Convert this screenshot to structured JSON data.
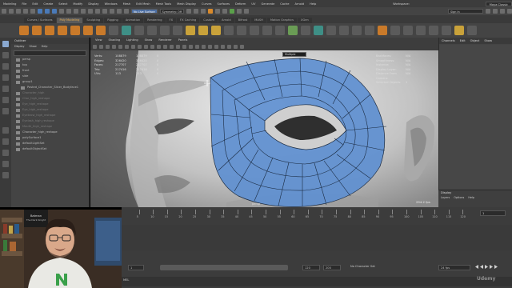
{
  "menubar": {
    "workspace_mode": "Modeling",
    "items": [
      "File",
      "Edit",
      "Create",
      "Select",
      "Modify",
      "Display",
      "Windows",
      "Mesh",
      "Edit Mesh",
      "Mesh Tools",
      "Mesh Display",
      "Curves",
      "Surfaces",
      "Deform",
      "UV",
      "Generate",
      "Cache",
      "Arnold",
      "Help"
    ],
    "workspace_label": "Workspace:",
    "workspace_value": "Maya Classic"
  },
  "statusline": {
    "symmetry": "Symmetry: Off",
    "no_live": "No Live Surface",
    "sign_in": "Sign In"
  },
  "shelf": {
    "tabs": [
      "Curves / Surfaces",
      "Poly Modeling",
      "Sculpting",
      "Rigging",
      "Animation",
      "Rendering",
      "FX",
      "FX Caching",
      "Custom",
      "Arnold",
      "Bifrost",
      "MASH",
      "Motion Graphics",
      "XGen"
    ],
    "active_tab": "Poly Modeling"
  },
  "outliner": {
    "panel_title": "Outliner",
    "menu": [
      "Display",
      "Show",
      "Help"
    ],
    "items": [
      {
        "label": "persp",
        "dim": false,
        "level": 1,
        "selected": false
      },
      {
        "label": "top",
        "dim": false,
        "level": 1,
        "selected": false
      },
      {
        "label": "front",
        "dim": false,
        "level": 1,
        "selected": false
      },
      {
        "label": "side",
        "dim": false,
        "level": 1,
        "selected": false
      },
      {
        "label": "group1",
        "dim": false,
        "level": 1,
        "selected": false
      },
      {
        "label": "Pasted_Character_Slicer_Bodyface1",
        "dim": false,
        "level": 2,
        "selected": false
      },
      {
        "label": "Character_high",
        "dim": true,
        "level": 1,
        "selected": false
      },
      {
        "label": "Char_high_reshape",
        "dim": true,
        "level": 1,
        "selected": false
      },
      {
        "label": "Eye_high_reshape",
        "dim": true,
        "level": 1,
        "selected": false
      },
      {
        "label": "Eye_high_reshape",
        "dim": true,
        "level": 1,
        "selected": false
      },
      {
        "label": "Eyebrow_high_reshape",
        "dim": true,
        "level": 1,
        "selected": false
      },
      {
        "label": "Eyelash_high_reshape",
        "dim": true,
        "level": 1,
        "selected": false
      },
      {
        "label": "Mouth_high_reshape",
        "dim": true,
        "level": 1,
        "selected": false
      },
      {
        "label": "Character_high_reshape",
        "dim": false,
        "level": 1,
        "selected": false
      },
      {
        "label": "polySurface1",
        "dim": false,
        "level": 1,
        "selected": false
      },
      {
        "label": "defaultLightSet",
        "dim": false,
        "level": 1,
        "selected": false
      },
      {
        "label": "defaultObjectSet",
        "dim": false,
        "level": 1,
        "selected": false
      }
    ]
  },
  "viewport": {
    "menu": [
      "View",
      "Shading",
      "Lighting",
      "Show",
      "Renderer",
      "Panels"
    ],
    "hud_rows": [
      {
        "label": "Verts:",
        "a": "108879",
        "b": "108879",
        "c": "0"
      },
      {
        "label": "Edges:",
        "a": "326420",
        "b": "326420",
        "c": "0"
      },
      {
        "label": "Faces:",
        "a": "217707",
        "b": "217707",
        "c": "0"
      },
      {
        "label": "Tris:",
        "a": "217416",
        "b": "217416",
        "c": "0"
      },
      {
        "label": "UVs:",
        "a": "113",
        "b": "113",
        "c": "0"
      }
    ],
    "hud_field": "Multiple",
    "hud_right": [
      {
        "label": "Backfaces:",
        "value": "N/A"
      },
      {
        "label": "Smoothness:",
        "value": "N/A"
      },
      {
        "label": "Instance:",
        "value": "N/A"
      },
      {
        "label": "Display Layer:",
        "value": "N/A"
      },
      {
        "label": "Distance From Camera:",
        "value": "N/A"
      },
      {
        "label": "Selected Objects:",
        "value": "1"
      }
    ],
    "camera": "persp",
    "fps": "294.2 fps",
    "mesh_color": "#5e8fd0",
    "skin_color": "#c9c9c9"
  },
  "rightpanel": {
    "tabs": [
      "Channels",
      "Edit",
      "Object",
      "Show"
    ],
    "layers_title": "Display",
    "layers_menu": [
      "Layers",
      "Options",
      "Help"
    ]
  },
  "timeline": {
    "ticks": [
      "5",
      "10",
      "15",
      "20",
      "25",
      "30",
      "35",
      "40",
      "45",
      "50",
      "55",
      "60",
      "65",
      "70",
      "75",
      "80",
      "85",
      "90",
      "95",
      "100",
      "105",
      "110",
      "115",
      "120"
    ],
    "current_frame": "1",
    "range_start": "1",
    "range_end_a": "120",
    "range_end_b": "200",
    "charset": "No Character Set",
    "fps": "24 fps",
    "mel": "MEL"
  },
  "overlay": {
    "watermark": "Udemy",
    "poster_line1": "Batman",
    "poster_line2": "The Dark Knight"
  }
}
